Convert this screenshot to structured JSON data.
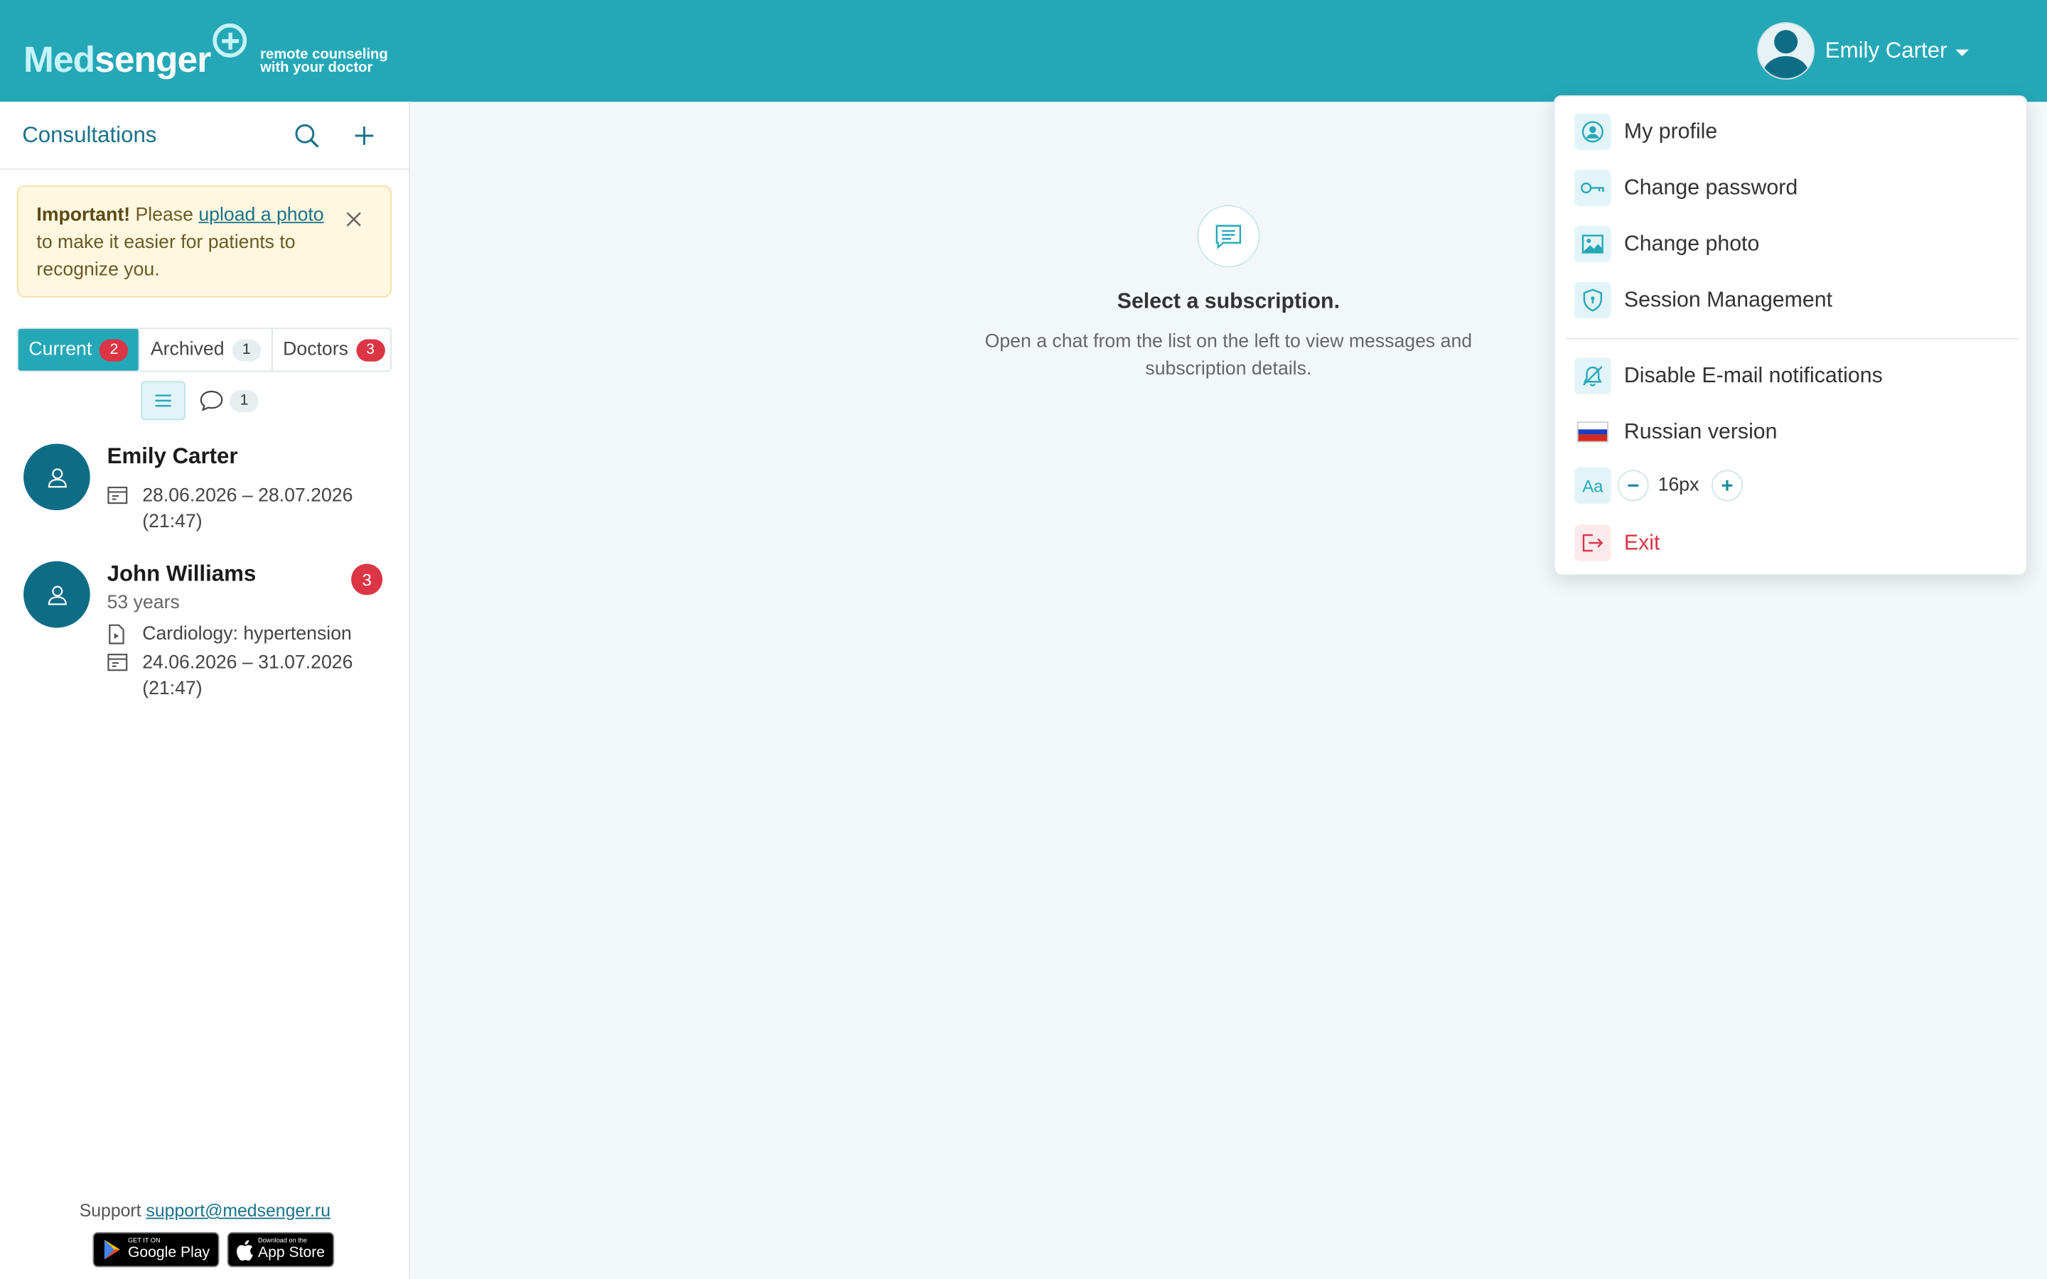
{
  "header": {
    "logo_med": "Med",
    "logo_senger": "senger",
    "logo_tagline_1": "remote counseling",
    "logo_tagline_2": "with your doctor",
    "user_name": "Emily Carter"
  },
  "sidebar": {
    "title": "Consultations",
    "notice": {
      "strong": "Important!",
      "pre": " Please ",
      "link": "upload a photo",
      "post": " to make it easier for patients to recognize you."
    },
    "tabs": [
      {
        "label": "Current",
        "count": "2",
        "active": true
      },
      {
        "label": "Archived",
        "count": "1",
        "active": false
      },
      {
        "label": "Doctors",
        "count": "3",
        "active": false
      }
    ],
    "chat_filter_count": "1",
    "patients": [
      {
        "name": "Emily Carter",
        "period": "28.06.2026 – 28.07.2026",
        "time": "(21:47)"
      },
      {
        "name": "John Williams",
        "age": "53 years",
        "program": "Cardiology: hypertension",
        "period": "24.06.2026 – 31.07.2026",
        "time": "(21:47)",
        "badge": "3"
      }
    ],
    "support_label": "Support",
    "support_email": "support@medsenger.ru",
    "stores": [
      {
        "small": "GET IT ON",
        "big": "Google Play"
      },
      {
        "small": "Download on the",
        "big": "App Store"
      }
    ]
  },
  "main": {
    "empty_title": "Select a subscription.",
    "empty_text": "Open a chat from the list on the left to view messages and subscription details."
  },
  "dropdown": {
    "items": [
      {
        "label": "My profile",
        "icon": "user-circle-icon"
      },
      {
        "label": "Change password",
        "icon": "key-icon"
      },
      {
        "label": "Change photo",
        "icon": "image-icon"
      },
      {
        "label": "Session Management",
        "icon": "shield-icon"
      },
      {
        "label": "Disable E-mail notifications",
        "icon": "bell-off-icon"
      },
      {
        "label": "Russian version",
        "icon": "russian-flag-icon"
      },
      {
        "label": "Exit",
        "icon": "logout-icon"
      }
    ],
    "font_aa": "Aa",
    "font_size": "16px"
  },
  "colors": {
    "brand": "#24a8b7",
    "dark_teal": "#0e6d86",
    "danger": "#dc3545"
  }
}
